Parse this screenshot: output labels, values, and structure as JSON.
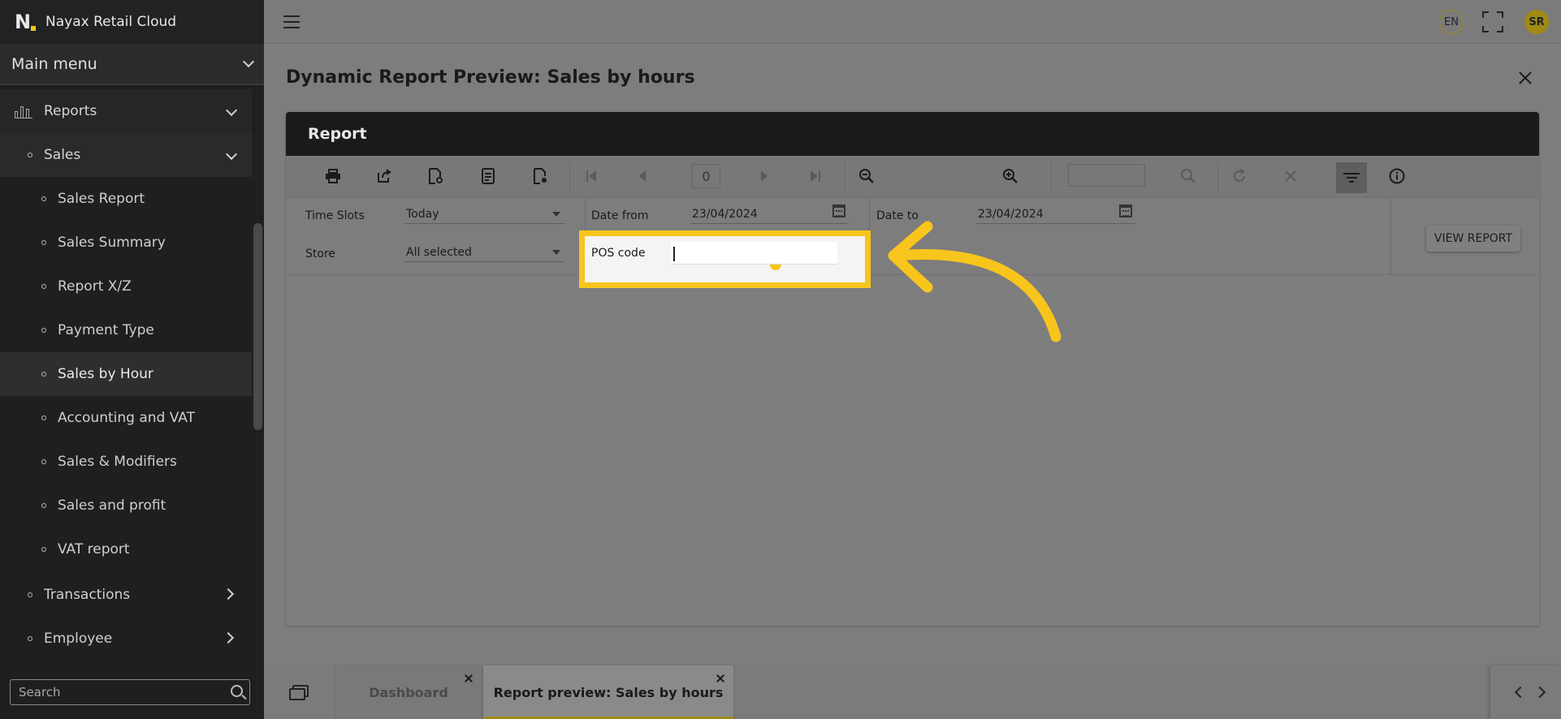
{
  "app": {
    "name": "Nayax Retail Cloud",
    "logo_letter": "N"
  },
  "sidebar": {
    "main_menu_label": "Main menu",
    "reports_label": "Reports",
    "sales_label": "Sales",
    "sales_items": [
      {
        "label": "Sales Report",
        "active": false
      },
      {
        "label": "Sales Summary",
        "active": false
      },
      {
        "label": "Report X/Z",
        "active": false
      },
      {
        "label": "Payment Type",
        "active": false
      },
      {
        "label": "Sales by Hour",
        "active": true
      },
      {
        "label": "Accounting and VAT",
        "active": false
      },
      {
        "label": "Sales & Modifiers",
        "active": false
      },
      {
        "label": "Sales and profit",
        "active": false
      },
      {
        "label": "VAT report",
        "active": false
      }
    ],
    "transactions_label": "Transactions",
    "employee_label": "Employee",
    "search_placeholder": "Search"
  },
  "topbar": {
    "language": "EN",
    "user_initials": "SR"
  },
  "page": {
    "title": "Dynamic Report Preview: Sales by hours"
  },
  "report": {
    "header": "Report",
    "page_number": "0",
    "params": {
      "time_slots_label": "Time Slots",
      "time_slots_value": "Today",
      "store_label": "Store",
      "store_value": "All selected",
      "date_from_label": "Date from",
      "date_from_value": "23/04/2024",
      "date_to_label": "Date to",
      "date_to_value": "23/04/2024",
      "pos_code_label": "POS code",
      "pos_code_value": ""
    },
    "view_report_label": "VIEW REPORT"
  },
  "tabs": [
    {
      "label": "Dashboard",
      "active": false
    },
    {
      "label": "Report preview: Sales by hours",
      "active": true
    }
  ],
  "colors": {
    "highlight": "#f8c51c",
    "accent": "#a08a14",
    "sidebar_bg": "#1f1f1f"
  }
}
